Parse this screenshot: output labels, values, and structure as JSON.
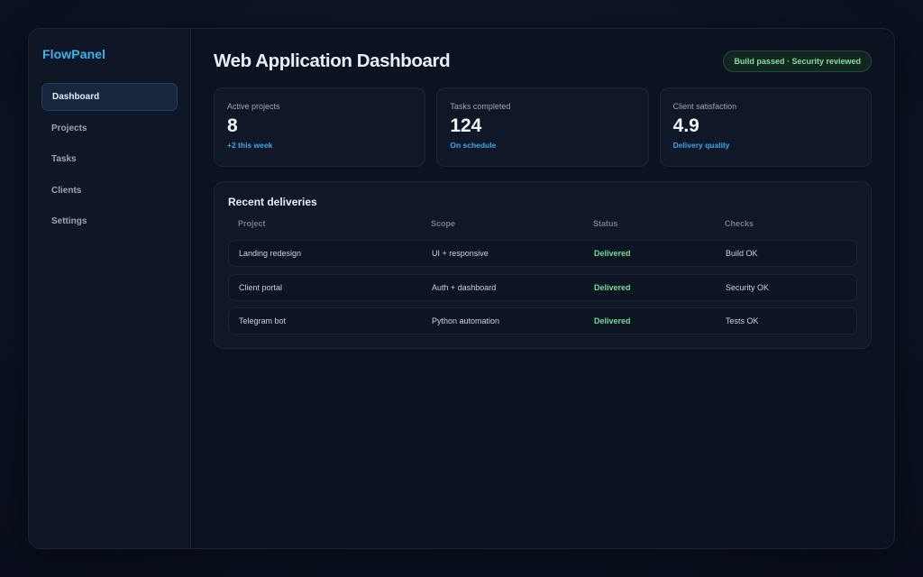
{
  "brand": "FlowPanel",
  "nav": [
    {
      "label": "Dashboard",
      "active": true
    },
    {
      "label": "Projects",
      "active": false
    },
    {
      "label": "Tasks",
      "active": false
    },
    {
      "label": "Clients",
      "active": false
    },
    {
      "label": "Settings",
      "active": false
    }
  ],
  "header": {
    "title": "Web Application Dashboard",
    "badge": "Build passed · Security reviewed"
  },
  "stats": [
    {
      "label": "Active projects",
      "value": "8",
      "note": "+2 this week"
    },
    {
      "label": "Tasks completed",
      "value": "124",
      "note": "On schedule"
    },
    {
      "label": "Client satisfaction",
      "value": "4.9",
      "note": "Delivery quality"
    }
  ],
  "deliveries": {
    "title": "Recent deliveries",
    "columns": [
      "Project",
      "Scope",
      "Status",
      "Checks"
    ],
    "rows": [
      {
        "project": "Landing redesign",
        "scope": "UI + responsive",
        "status": "Delivered",
        "checks": "Build OK"
      },
      {
        "project": "Client portal",
        "scope": "Auth + dashboard",
        "status": "Delivered",
        "checks": "Security OK"
      },
      {
        "project": "Telegram bot",
        "scope": "Python automation",
        "status": "Delivered",
        "checks": "Tests OK"
      }
    ]
  },
  "colors": {
    "brand": "#38b6f0",
    "accent_note": "#3aa9e8",
    "success": "#6fe08f",
    "background": "#0c1221"
  }
}
